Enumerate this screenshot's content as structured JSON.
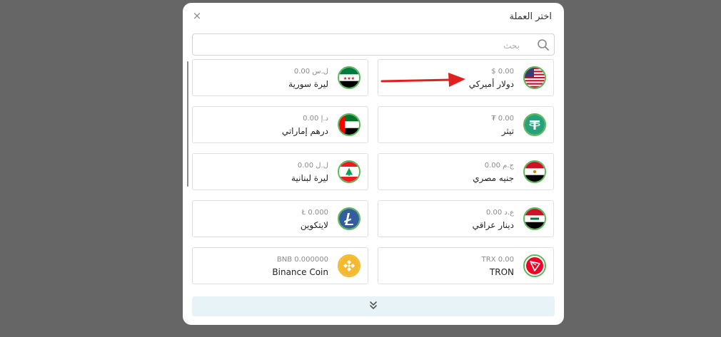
{
  "dialog": {
    "title": "اختر العملة",
    "close_label": "×",
    "search_placeholder": "بحث"
  },
  "currencies": [
    {
      "amount": "$ 0.00",
      "name": "دولار أميركي",
      "icon": "us-flag-icon"
    },
    {
      "amount": "0.00 ل.س",
      "name": "ليرة سورية",
      "icon": "syria-flag-icon"
    },
    {
      "amount": "₮ 0.00",
      "name": "تيثر",
      "icon": "tether-icon"
    },
    {
      "amount": "0.00 د.إ",
      "name": "درهم إماراتي",
      "icon": "uae-flag-icon"
    },
    {
      "amount": "0.00 ج.م",
      "name": "جنيه مصري",
      "icon": "egypt-flag-icon"
    },
    {
      "amount": "0.00 ل.ل",
      "name": "ليرة لبنانية",
      "icon": "lebanon-flag-icon"
    },
    {
      "amount": "0.00 ع.د",
      "name": "دينار عراقي",
      "icon": "iraq-flag-icon"
    },
    {
      "amount": "Ł 0.000",
      "name": "لايتكوين",
      "icon": "litecoin-icon"
    },
    {
      "amount": "TRX 0.00",
      "name": "TRON",
      "icon": "tron-icon"
    },
    {
      "amount": "BNB 0.000000",
      "name": "Binance Coin",
      "icon": "binance-icon"
    }
  ],
  "colors": {
    "overlay": "#666666",
    "card_border": "#dcdfe3",
    "flag_ring": "#5cb85c",
    "load_more_bg": "#e8f3f8",
    "annotation_arrow": "#e02020"
  }
}
